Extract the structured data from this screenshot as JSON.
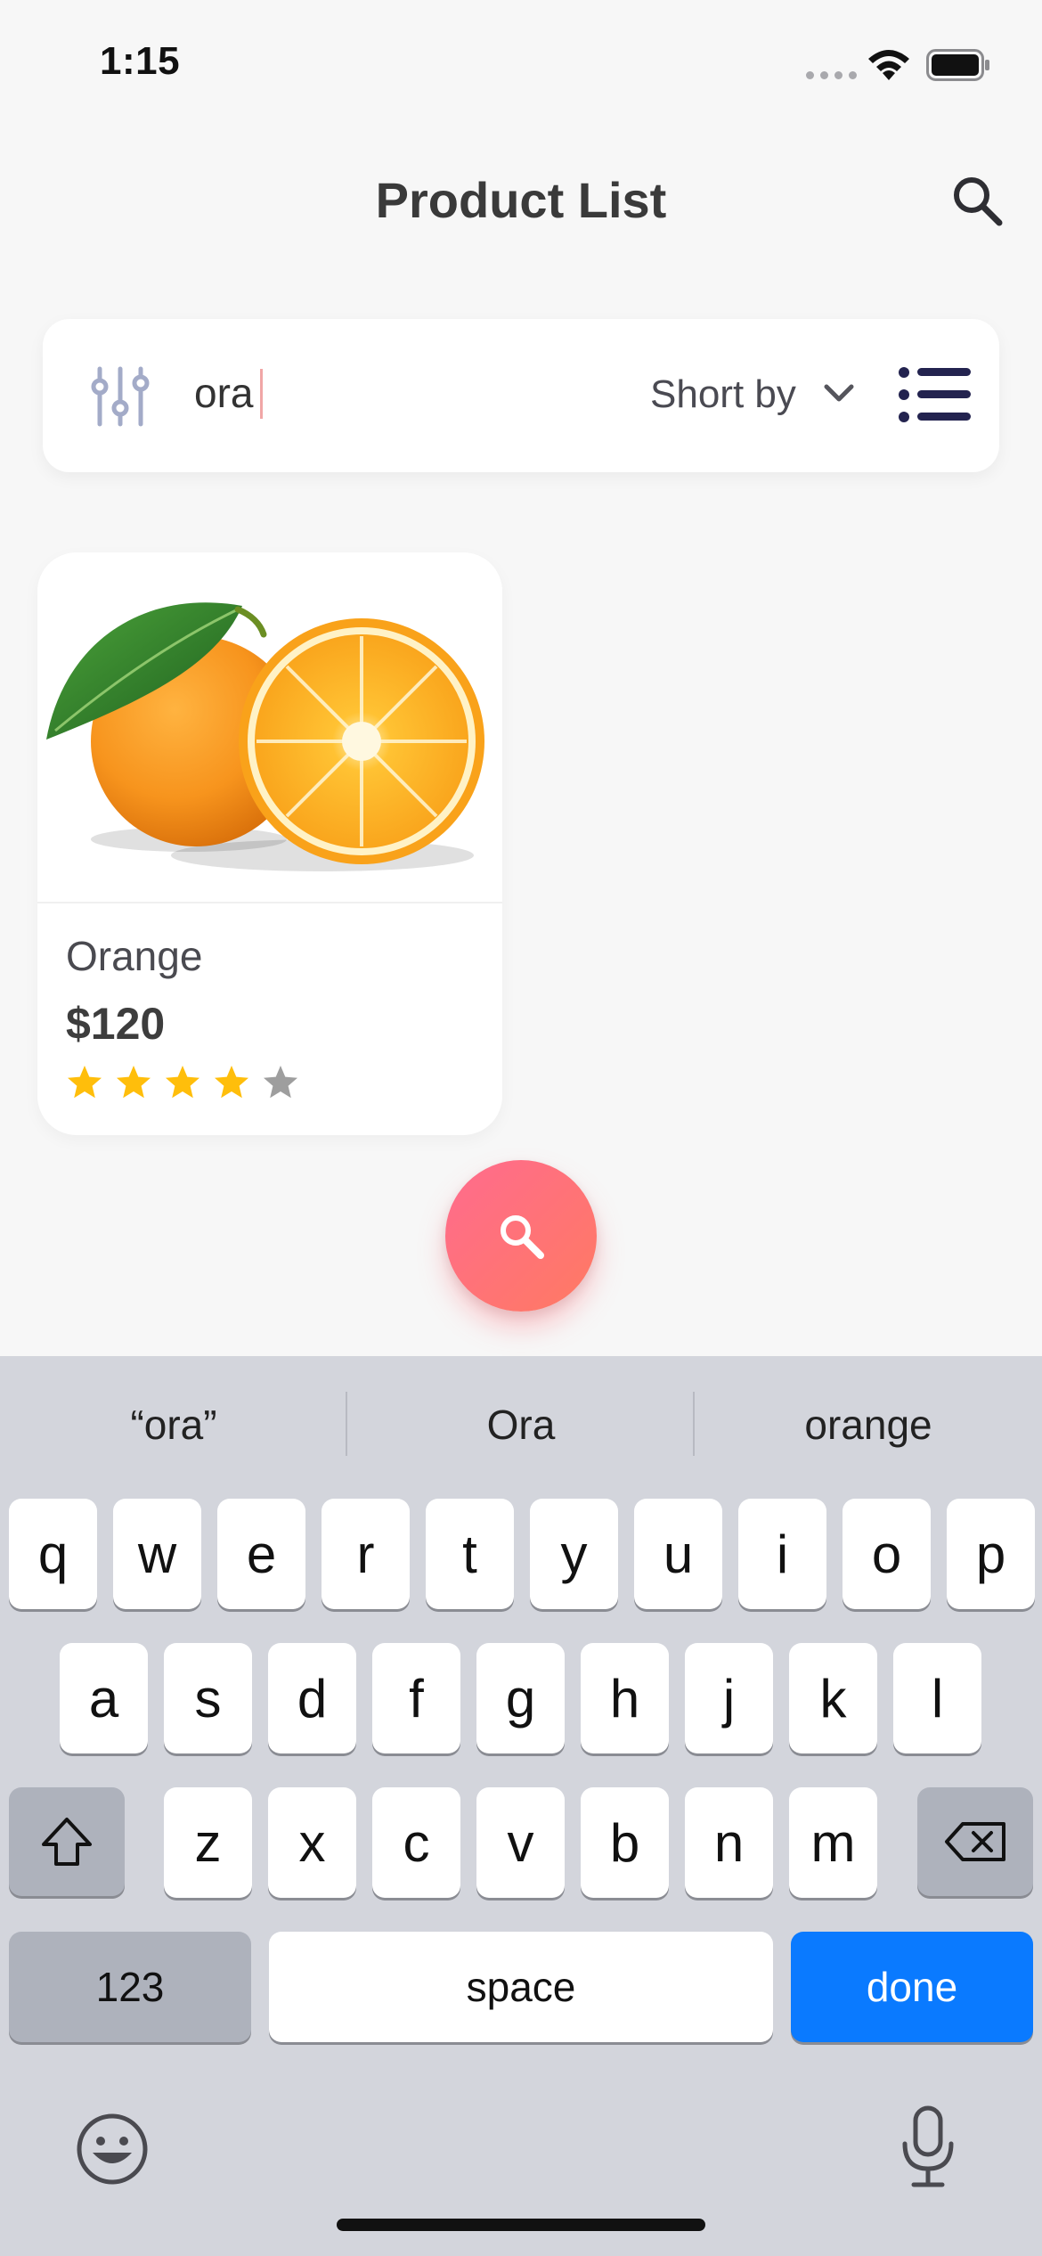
{
  "status_bar": {
    "time": "1:15"
  },
  "header": {
    "title": "Product List",
    "search_icon": "search-icon"
  },
  "filter_bar": {
    "filter_icon": "sliders-icon",
    "search_value": "ora",
    "sort_label": "Short by",
    "sort_icon": "chevron-down-icon",
    "view_icon": "list-view-icon"
  },
  "products": [
    {
      "name": "Orange",
      "price": "$120",
      "rating": 4,
      "max_rating": 5,
      "image": "orange-image"
    }
  ],
  "fab": {
    "icon": "search-icon",
    "color_start": "#ff6b8e",
    "color_end": "#ff7a62"
  },
  "keyboard": {
    "suggestions": [
      "“ora”",
      "Ora",
      "orange"
    ],
    "row1": [
      "q",
      "w",
      "e",
      "r",
      "t",
      "y",
      "u",
      "i",
      "o",
      "p"
    ],
    "row2": [
      "a",
      "s",
      "d",
      "f",
      "g",
      "h",
      "j",
      "k",
      "l"
    ],
    "row3": [
      "z",
      "x",
      "c",
      "v",
      "b",
      "n",
      "m"
    ],
    "numbers_label": "123",
    "space_label": "space",
    "done_label": "done",
    "shift_icon": "shift-icon",
    "delete_icon": "backspace-icon",
    "emoji_icon": "emoji-icon",
    "mic_icon": "microphone-icon"
  },
  "colors": {
    "accent_blue": "#0a7aff",
    "star_filled": "#ffbe0b",
    "star_empty": "#9e9e9e",
    "list_icon": "#23234f"
  }
}
